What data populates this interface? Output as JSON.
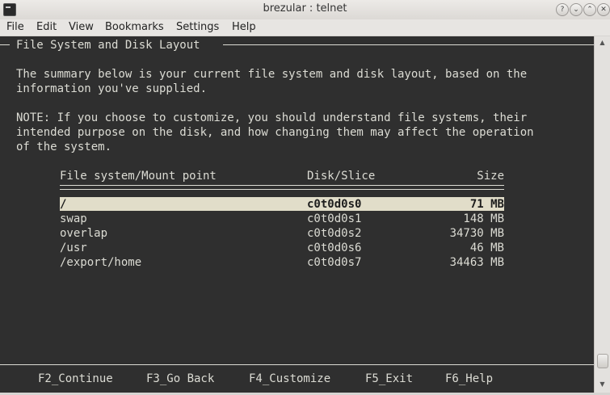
{
  "window": {
    "title": "brezular : telnet"
  },
  "menu": [
    "File",
    "Edit",
    "View",
    "Bookmarks",
    "Settings",
    "Help"
  ],
  "terminal": {
    "section_title": "File System and Disk Layout",
    "summary": [
      "The summary below is your current file system and disk layout, based on the",
      "information you've supplied."
    ],
    "note": [
      "NOTE: If you choose to customize, you should understand file systems, their",
      "intended purpose on the disk, and how changing them may affect the operation",
      "of the system."
    ],
    "table": {
      "headers": {
        "mount": "File system/Mount point",
        "slice": "Disk/Slice",
        "size": "Size"
      },
      "rows": [
        {
          "mount": "/",
          "slice": "c0t0d0s0",
          "size": "71 MB",
          "selected": true
        },
        {
          "mount": "swap",
          "slice": "c0t0d0s1",
          "size": "148 MB"
        },
        {
          "mount": "overlap",
          "slice": "c0t0d0s2",
          "size": "34730 MB"
        },
        {
          "mount": "/usr",
          "slice": "c0t0d0s6",
          "size": "46 MB"
        },
        {
          "mount": "/export/home",
          "slice": "c0t0d0s7",
          "size": "34463 MB"
        }
      ]
    },
    "fkeys": [
      "F2_Continue",
      "F3_Go Back",
      "F4_Customize",
      "F5_Exit",
      "F6_Help"
    ]
  },
  "icons": {
    "title_buttons": [
      "help-icon",
      "minimize-icon",
      "maximize-icon",
      "close-icon"
    ],
    "scroll_buttons": [
      "scroll-up-icon",
      "scroll-down-icon"
    ]
  }
}
